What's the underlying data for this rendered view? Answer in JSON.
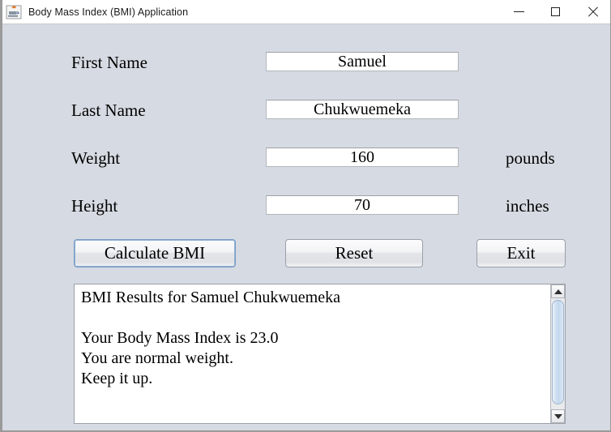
{
  "window": {
    "title": "Body Mass Index (BMI) Application",
    "icon": "java-coffee-cup-icon",
    "controls": {
      "minimize": "minimize-icon",
      "maximize": "maximize-icon",
      "close": "close-icon"
    }
  },
  "form": {
    "rows": [
      {
        "label": "First Name",
        "value": "Samuel",
        "unit": ""
      },
      {
        "label": "Last Name",
        "value": "Chukwuemeka",
        "unit": ""
      },
      {
        "label": "Weight",
        "value": "160",
        "unit": "pounds"
      },
      {
        "label": "Height",
        "value": "70",
        "unit": "inches"
      }
    ]
  },
  "buttons": {
    "calculate": "Calculate BMI",
    "reset": "Reset",
    "exit": "Exit"
  },
  "results": {
    "text": "BMI Results for Samuel Chukwuemeka\n\nYour Body Mass Index is 23.0\nYou are normal weight.\nKeep it up."
  },
  "colors": {
    "window_background": "#d6dae2",
    "titlebar_background": "#ffffff",
    "field_background": "#ffffff",
    "focus_border": "#7a9cc6",
    "scrollbar_thumb": "#c3d8ef",
    "text": "#000000"
  }
}
